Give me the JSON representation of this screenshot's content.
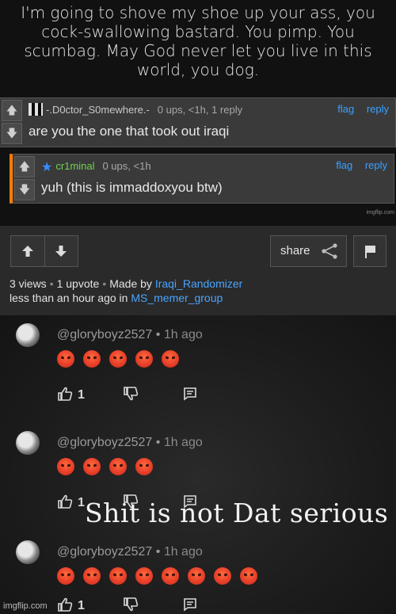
{
  "quote": {
    "lines": [
      "I'm going to shove my shoe up your ass, you",
      "cock-swallowing bastard. You pimp. You",
      "scumbag. May God never let you live in this",
      "world, you dog."
    ]
  },
  "comments": [
    {
      "username": "-.D0ctor_S0mewhere.-",
      "stats": "0 ups, <1h, 1 reply",
      "text": "are you the one that took out iraqi",
      "flag": "flag",
      "reply": "reply"
    },
    {
      "username": "cr1minal",
      "stats": "0 ups, <1h",
      "text": "yuh (this is immaddoxyou btw)",
      "flag": "flag",
      "reply": "reply",
      "accent_color": "#ff7a00",
      "username_color": "#6fd24f"
    }
  ],
  "watermark_small": "imgflip.com",
  "post": {
    "share_label": "share",
    "views": "3 views",
    "upvotes": "1 upvote",
    "made_by_label": "Made by",
    "author": "Iraqi_Randomizer",
    "time_label": "less than an hour ago in",
    "group": "MS_memer_group"
  },
  "yt_comments": [
    {
      "user": "@gloryboyz2527",
      "time": "1h ago",
      "emoji_count": 5,
      "likes": "1"
    },
    {
      "user": "@gloryboyz2527",
      "time": "1h ago",
      "emoji_count": 4,
      "likes": "1"
    },
    {
      "user": "@gloryboyz2527",
      "time": "1h ago",
      "emoji_count": 8,
      "likes": "1"
    }
  ],
  "overlay_text": "Shit is not Dat serious",
  "watermark": "imgflip.com",
  "colors": {
    "link": "#4aa4ff",
    "accent": "#ff7a00"
  }
}
